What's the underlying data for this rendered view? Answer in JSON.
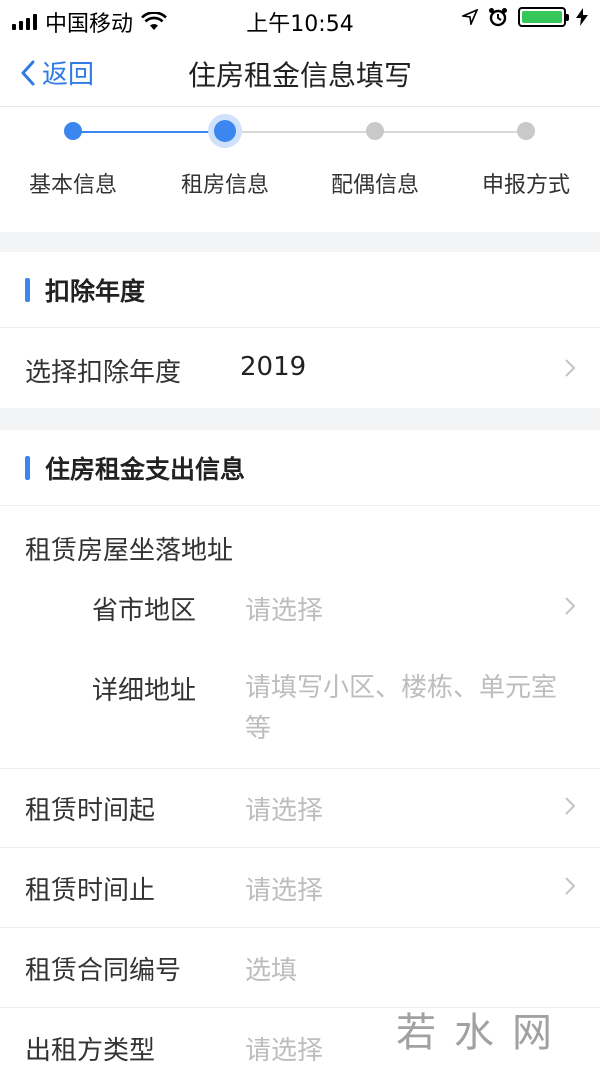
{
  "status_bar": {
    "carrier": "中国移动",
    "time": "上午10:54"
  },
  "nav": {
    "back_label": "返回",
    "title": "住房租金信息填写"
  },
  "steps": [
    {
      "label": "基本信息",
      "state": "done"
    },
    {
      "label": "租房信息",
      "state": "current"
    },
    {
      "label": "配偶信息",
      "state": "pending"
    },
    {
      "label": "申报方式",
      "state": "pending"
    }
  ],
  "section_year": {
    "title": "扣除年度",
    "row_label": "选择扣除年度",
    "row_value": "2019"
  },
  "section_rent": {
    "title": "住房租金支出信息",
    "address_group_label": "租赁房屋坐落地址",
    "province": {
      "label": "省市地区",
      "placeholder": "请选择"
    },
    "detail": {
      "label": "详细地址",
      "placeholder": "请填写小区、楼栋、单元室等"
    },
    "start": {
      "label": "租赁时间起",
      "placeholder": "请选择"
    },
    "end": {
      "label": "租赁时间止",
      "placeholder": "请选择"
    },
    "contract": {
      "label": "租赁合同编号",
      "placeholder": "选填"
    },
    "landlord_type": {
      "label": "出租方类型",
      "placeholder": "请选择"
    }
  },
  "watermark": {
    "text": "若水网"
  },
  "colors": {
    "accent": "#3c86f0",
    "back_link": "#2f7be6",
    "placeholder": "#bdbdbd",
    "inactive_step": "#c9c9c9",
    "section_gap": "#f3f4f6"
  }
}
